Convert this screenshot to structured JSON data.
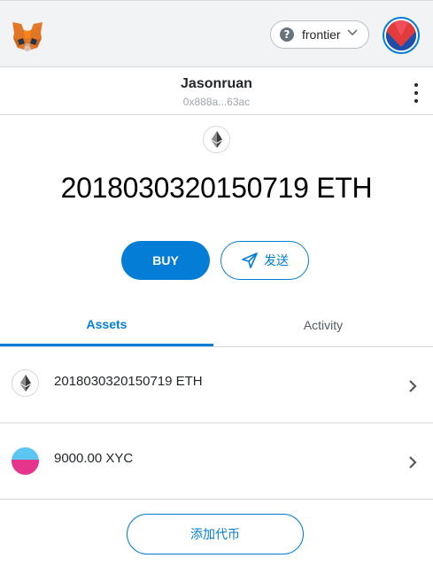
{
  "header": {
    "logo_icon": "metamask-fox-icon",
    "network": {
      "name": "frontier",
      "help_icon": "question-circle-icon",
      "dropdown_icon": "chevron-down-icon"
    },
    "avatar_icon": "account-identicon"
  },
  "account": {
    "name": "Jasonruan",
    "address": "0x888a...63ac",
    "menu_icon": "kebab-menu-icon"
  },
  "balance": {
    "icon": "ethereum-icon",
    "text": "2018030320150719 ETH"
  },
  "actions": {
    "buy_label": "BUY",
    "send_label": "发送",
    "send_icon": "send-arrow-icon"
  },
  "tabs": [
    {
      "label": "Assets",
      "active": true
    },
    {
      "label": "Activity",
      "active": false
    }
  ],
  "assets": [
    {
      "icon": "ethereum-icon",
      "label": "2018030320150719 ETH"
    },
    {
      "icon": "xyc-token-icon",
      "label": "9000.00 XYC"
    }
  ],
  "add_token_label": "添加代币",
  "colors": {
    "accent": "#037dd6",
    "header_bg": "#f2f3f4",
    "divider": "#d6d9dc",
    "muted_text": "#9fa6ae"
  }
}
